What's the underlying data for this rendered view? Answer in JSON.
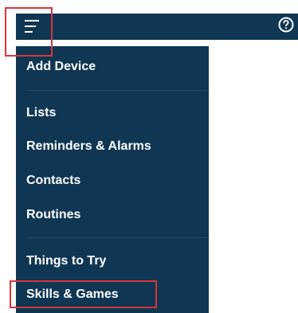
{
  "colors": {
    "app_bar": "#0f3652",
    "drawer": "#0f3652",
    "menu_text": "#ffffff",
    "highlight_box": "#d9343b"
  },
  "header": {
    "menu_icon": "hamburger-menu-icon",
    "help_icon": "question-circle-icon"
  },
  "menu": {
    "add_device": "Add Device",
    "lists": "Lists",
    "reminders_alarms": "Reminders & Alarms",
    "contacts": "Contacts",
    "routines": "Routines",
    "things_to_try": "Things to Try",
    "skills_games": "Skills & Games"
  }
}
